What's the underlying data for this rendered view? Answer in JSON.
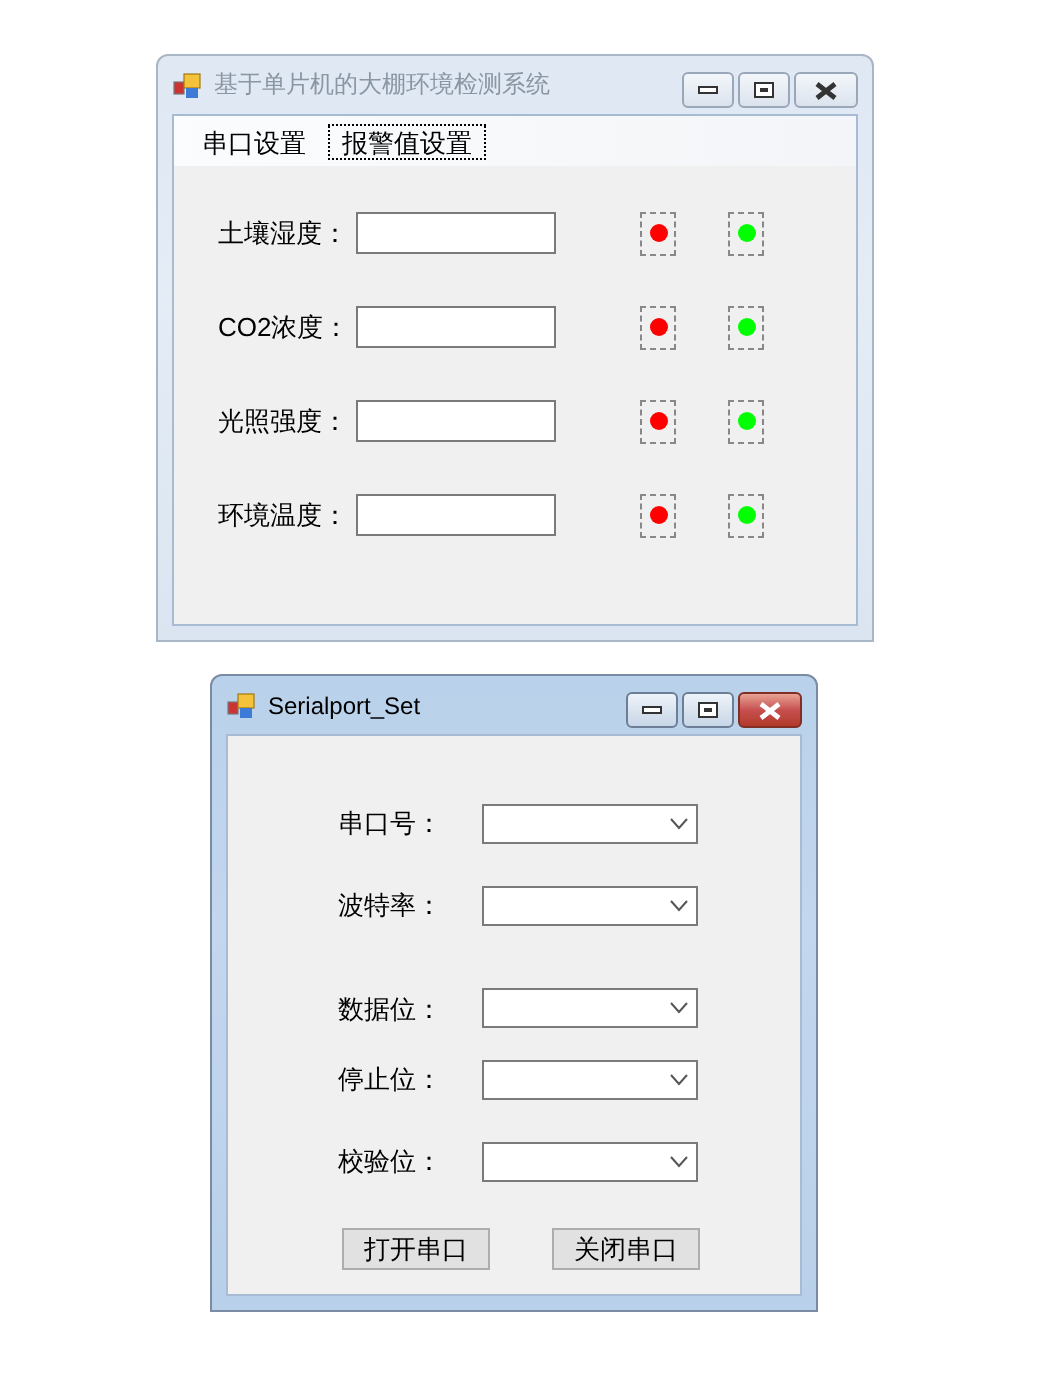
{
  "main_window": {
    "title": "基于单片机的大棚环境检测系统",
    "active": false,
    "menu": [
      {
        "label": "串口设置",
        "selected": false
      },
      {
        "label": "报警值设置",
        "selected": true
      }
    ],
    "rows": [
      {
        "label": "土壤湿度：",
        "indicators": [
          {
            "color": "#ff0000"
          },
          {
            "color": "#00ff00"
          }
        ]
      },
      {
        "label": "CO2浓度：",
        "indicators": [
          {
            "color": "#ff0000"
          },
          {
            "color": "#00ff00"
          }
        ]
      },
      {
        "label": "光照强度：",
        "indicators": [
          {
            "color": "#ff0000"
          },
          {
            "color": "#00ff00"
          }
        ]
      },
      {
        "label": "环境温度：",
        "indicators": [
          {
            "color": "#ff0000"
          },
          {
            "color": "#00ff00"
          }
        ]
      }
    ]
  },
  "serialport_window": {
    "title": "Serialport_Set",
    "active": true,
    "fields": [
      {
        "label": "串口号："
      },
      {
        "label": "波特率："
      },
      {
        "label": "数据位："
      },
      {
        "label": "停止位："
      },
      {
        "label": "校验位："
      }
    ],
    "buttons": [
      "打开串口",
      "关闭串口"
    ]
  }
}
